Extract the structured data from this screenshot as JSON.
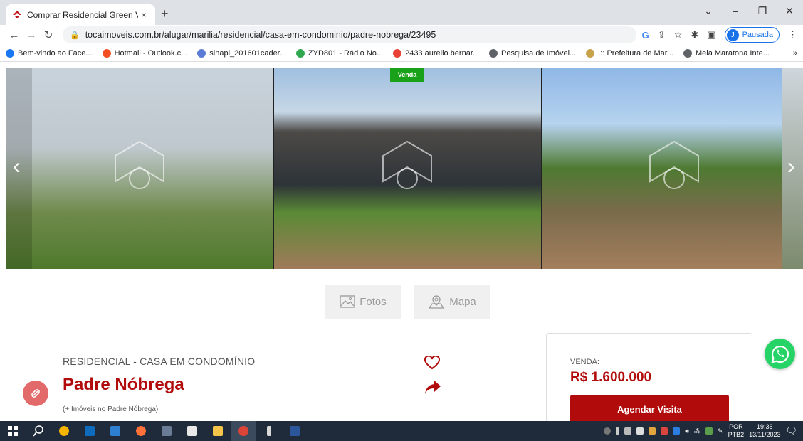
{
  "browser": {
    "tab_title": "Comprar Residencial Green Vale",
    "tab_close": "×",
    "new_tab": "+",
    "url": "tocaimoveis.com.br/alugar/marilia/residencial/casa-em-condominio/padre-nobrega/23495",
    "profile_initial": "J",
    "profile_label": "Pausada",
    "window_minimize": "–",
    "window_restore": "❐",
    "window_close": "✕",
    "window_tabsearch": "⌄"
  },
  "bookmarks": [
    {
      "label": "Bem-vindo ao Face...",
      "color": "#1877f2"
    },
    {
      "label": "Hotmail - Outlook.c...",
      "color": "#f25022"
    },
    {
      "label": "sinapi_201601cader...",
      "color": "#5a7bd6"
    },
    {
      "label": "ZYD801 - Rádio No...",
      "color": "#2fa84f"
    },
    {
      "label": "2433 aurelio bernar...",
      "color": "#e94235"
    },
    {
      "label": "Pesquisa de Imóvei...",
      "color": "#5f6368"
    },
    {
      "label": ".:: Prefeitura de Mar...",
      "color": "#c8a24a"
    },
    {
      "label": "Meia Maratona Inte...",
      "color": "#5f6368"
    }
  ],
  "bookmarks_more": "»",
  "gallery": {
    "badge": "Venda",
    "prev": "‹",
    "next": "›"
  },
  "buttons": {
    "photos": "Fotos",
    "map": "Mapa"
  },
  "listing": {
    "category": "RESIDENCIAL - CASA EM CONDOMÍNIO",
    "name": "Padre Nóbrega",
    "more_link": "(+ Imóveis no Padre Nóbrega)"
  },
  "price": {
    "label": "VENDA:",
    "value": "R$ 1.600.000",
    "schedule_button": "Agendar Visita"
  },
  "taskbar": {
    "lang_top": "POR",
    "lang_bottom": "PTB2",
    "time": "19:36",
    "date": "13/11/2023"
  },
  "colors": {
    "brand_red": "#b10b0b",
    "badge_green": "#19a119",
    "whatsapp": "#25d366"
  }
}
